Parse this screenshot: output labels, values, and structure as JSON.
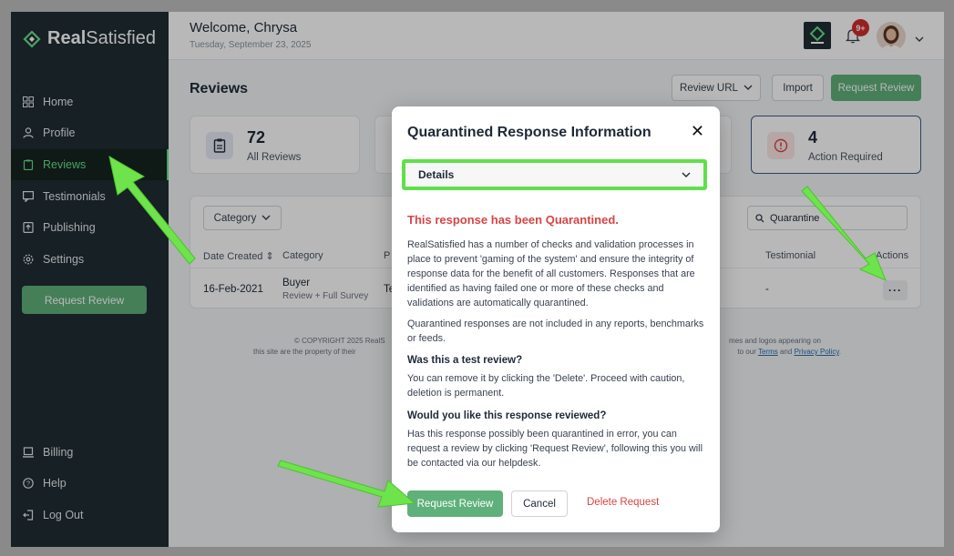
{
  "brand": {
    "name_bold": "Real",
    "name_light": "Satisfied",
    "accent": "#67e08a"
  },
  "topbar": {
    "welcome": "Welcome, Chrysa",
    "date": "Tuesday, September 23, 2025",
    "notification_count": "9+"
  },
  "sidebar": {
    "items": [
      {
        "label": "Home",
        "icon": "home-grid-icon"
      },
      {
        "label": "Profile",
        "icon": "user-icon"
      },
      {
        "label": "Reviews",
        "icon": "clipboard-icon"
      },
      {
        "label": "Testimonials",
        "icon": "chat-icon"
      },
      {
        "label": "Publishing",
        "icon": "publish-icon"
      },
      {
        "label": "Settings",
        "icon": "gear-icon"
      }
    ],
    "request_review": "Request Review",
    "bottom": [
      {
        "label": "Billing",
        "icon": "laptop-icon"
      },
      {
        "label": "Help",
        "icon": "help-icon"
      },
      {
        "label": "Log Out",
        "icon": "logout-icon"
      }
    ]
  },
  "page": {
    "title": "Reviews",
    "review_url": "Review URL",
    "import": "Import",
    "request_review": "Request Review",
    "stats": [
      {
        "value": "72",
        "label": "All Reviews"
      },
      {
        "value": "4",
        "label": "Action Required"
      }
    ],
    "category": "Category",
    "search_value": "Quarantine",
    "columns": [
      "Date Created",
      "Category",
      "P",
      "Testimonial",
      "Actions"
    ],
    "row": {
      "date": "16-Feb-2021",
      "category": "Buyer",
      "category_sub": "Review + Full Survey",
      "col3": "Te",
      "testimonial": "-"
    },
    "footer_left_1": "© COPYRIGHT 2025 RealS",
    "footer_left_2": "this site are the property of their",
    "footer_right_1": "mes and logos appearing on",
    "footer_right_2a": "to our",
    "footer_terms": "Terms",
    "footer_and": "and",
    "footer_privacy": "Privacy Policy"
  },
  "modal": {
    "title": "Quarantined Response Information",
    "details": "Details",
    "quarantined_heading": "This response has been Quarantined.",
    "p1": "RealSatisfied has a number of checks and validation processes in place to prevent 'gaming of the system' and ensure the integrity of response data for the benefit of all customers. Responses that are identified as having failed one or more of these checks and validations are automatically quarantined.",
    "p2": "Quarantined responses are not included in any reports, benchmarks or feeds.",
    "h_test": "Was this a test review?",
    "p_test": "You can remove it by clicking the 'Delete'. Proceed with caution, deletion is permanent.",
    "h_review": "Would you like this response reviewed?",
    "p_review": "Has this response possibly been quarantined in error, you can request a review by clicking 'Request Review', following this you will be contacted via our helpdesk.",
    "btn_request": "Request Review",
    "btn_cancel": "Cancel",
    "btn_delete": "Delete Request"
  }
}
